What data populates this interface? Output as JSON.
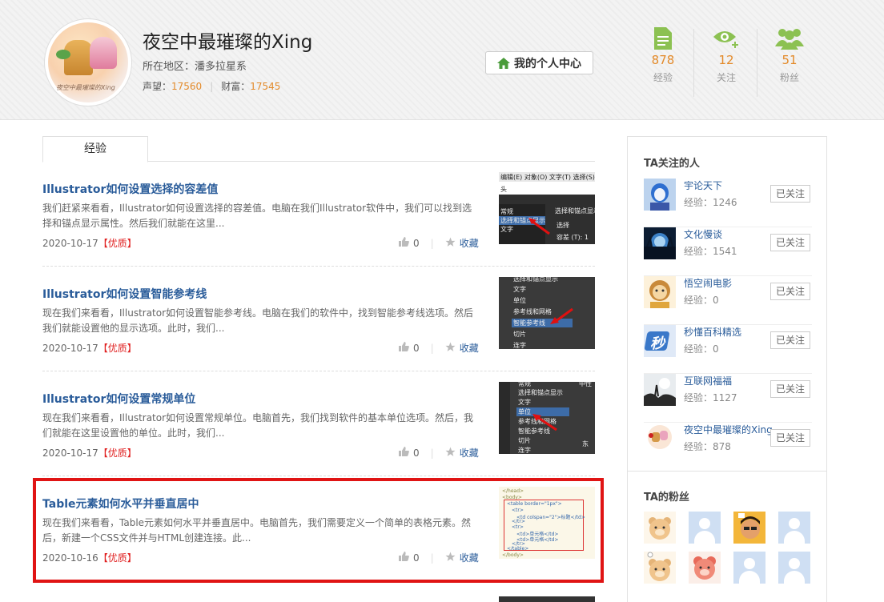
{
  "header": {
    "user_name": "夜空中最璀璨的Xing",
    "avatar_caption": "夜空中最璀璨的Xing",
    "location_label": "所在地区：",
    "location_value": "潘多拉星系",
    "reputation_label": "声望：",
    "reputation_value": "17560",
    "wealth_label": "财富：",
    "wealth_value": "17545",
    "center_button": "我的个人中心",
    "stats": [
      {
        "icon": "document-icon",
        "value": "878",
        "label": "经验"
      },
      {
        "icon": "eye-plus-icon",
        "value": "12",
        "label": "关注"
      },
      {
        "icon": "people-icon",
        "value": "51",
        "label": "粉丝"
      }
    ]
  },
  "tabs": [
    {
      "label": "经验"
    }
  ],
  "articles": [
    {
      "title": "Illustrator如何设置选择的容差值",
      "summary": "我们赶紧来看看，Illustrator如何设置选择的容差值。电脑在我们Illustrator软件中，我们可以找到选择和锚点显示属性。然后我们就能在这里...",
      "date": "2020-10-17",
      "badge": "【优质】",
      "likes": "0",
      "favorite": "收藏"
    },
    {
      "title": "Illustrator如何设置智能参考线",
      "summary": "现在我们来看看，Illustrator如何设置智能参考线。电脑在我们的软件中，找到智能参考线选项。然后我们就能设置他的显示选项。此时，我们...",
      "date": "2020-10-17",
      "badge": "【优质】",
      "likes": "0",
      "favorite": "收藏"
    },
    {
      "title": "Illustrator如何设置常规单位",
      "summary": "现在我们来看看，Illustrator如何设置常规单位。电脑首先，我们找到软件的基本单位选项。然后，我们就能在这里设置他的单位。此时，我们...",
      "date": "2020-10-17",
      "badge": "【优质】",
      "likes": "0",
      "favorite": "收藏"
    },
    {
      "title": "Table元素如何水平并垂直居中",
      "summary": "现在我们来看看，Table元素如何水平并垂直居中。电脑首先，我们需要定义一个简单的表格元素。然后，新建一个CSS文件并与HTML创建连接。此...",
      "date": "2020-10-16",
      "badge": "【优质】",
      "likes": "0",
      "favorite": "收藏"
    }
  ],
  "thumbs": {
    "t1": [
      "编辑(E)  对象(O)  文字(T)  选择(S)",
      "头",
      "选择和锚点显示",
      "常规",
      "选择和锚点显示",
      "文字",
      "选择",
      "单位",
      "容差 (T): 1"
    ],
    "t2": [
      "选择和锚点显示",
      "文字",
      "单位",
      "参考线和网格",
      "智能参考线",
      "切片",
      "连字"
    ],
    "t3": [
      "常规",
      "选择和锚点显示",
      "文字",
      "单位",
      "参考线和网格",
      "智能参考线",
      "切片",
      "连字",
      "中性",
      "东"
    ],
    "t4": [
      "</head>",
      "<body>",
      "<table border=\"1px\">",
      "<tr>",
      "<td colspan=\"2\">标题</td>",
      "</tr>",
      "<tr>",
      "<td>单元格</td>",
      "<td>单元格</td>",
      "</tr>",
      "</table>",
      "</body>"
    ]
  },
  "sidebar": {
    "following_title": "TA关注的人",
    "following": [
      {
        "name": "宇论天下",
        "exp": "经验：1246",
        "button": "已关注"
      },
      {
        "name": "文化慢谈",
        "exp": "经验：1541",
        "button": "已关注"
      },
      {
        "name": "悟空闹电影",
        "exp": "经验：0",
        "button": "已关注"
      },
      {
        "name": "秒懂百科精选",
        "exp": "经验：0",
        "button": "已关注"
      },
      {
        "name": "互联网福福",
        "exp": "经验：1127",
        "button": "已关注"
      },
      {
        "name": "夜空中最璀璨的Xing",
        "exp": "经验：878",
        "button": "已关注"
      }
    ],
    "fans_title": "TA的粉丝",
    "sec_avatar_text": "秒"
  },
  "colors": {
    "accent_orange": "#e38a2a",
    "link_blue": "#2a5c9a",
    "badge_red": "#e02020",
    "icon_green": "#8cc152",
    "highlight_red": "#e01414"
  }
}
